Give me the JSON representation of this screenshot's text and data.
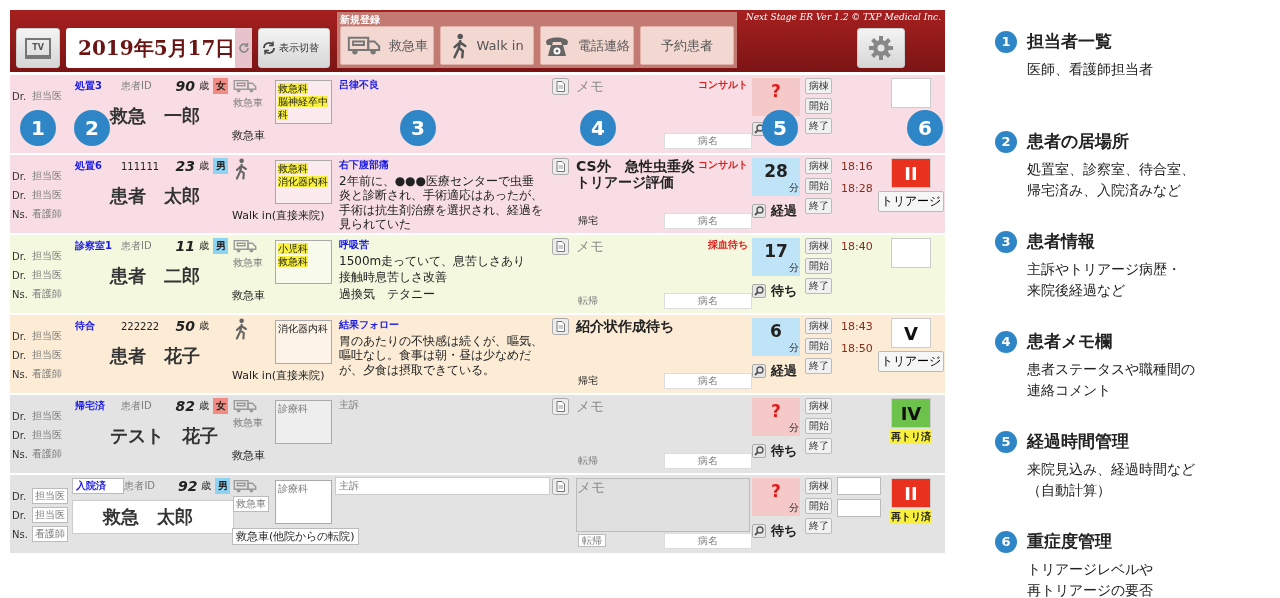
{
  "header": {
    "tv_button": "TV",
    "date": "2019年5月17日",
    "view_toggle": "表示切替",
    "register_group": {
      "title": "新規登録",
      "buttons": [
        {
          "kind": "ambulance",
          "label": "救急車"
        },
        {
          "kind": "walk",
          "label": "Walk in"
        },
        {
          "kind": "phone",
          "label": "電話連絡"
        },
        {
          "kind": "plain",
          "label": "予約患者"
        }
      ]
    },
    "version": "Next Stage ER Ver 1.2 © TXP Medical Inc."
  },
  "rows": [
    {
      "kind": "display",
      "color": "#f8dee4",
      "staff": [
        {
          "role": "Dr.",
          "placeholder": "担当医"
        }
      ],
      "location": "処置3",
      "patient_id": {
        "placeholder": "患者ID"
      },
      "age": "90",
      "age_unit": "歳",
      "sex": {
        "label": "女",
        "color": "#f08c84"
      },
      "name": "救急　一郎",
      "arrival": {
        "kind": "ambulance",
        "placeholder": "救急車",
        "label": "救急車"
      },
      "department": {
        "lines": [
          "救急科",
          "脳神経卒中科"
        ],
        "highlighted": true
      },
      "complaint": {
        "title": "呂律不良"
      },
      "memo": {
        "placeholder": "メモ"
      },
      "status": "コンサルト",
      "diagnosis": {
        "placeholder": "病名"
      },
      "timer": {
        "kind": "unknown",
        "value": "?"
      },
      "ward_buttons": [
        "病棟",
        "開始",
        "終了"
      ],
      "times": [],
      "triage": {
        "color": "#ffffff"
      }
    },
    {
      "kind": "display",
      "color": "#f8dee4",
      "staff": [
        {
          "role": "Dr.",
          "placeholder": "担当医"
        },
        {
          "role": "Dr.",
          "placeholder": "担当医"
        },
        {
          "role": "Ns.",
          "placeholder": "看護師"
        }
      ],
      "location": "処置6",
      "patient_id": {
        "value": "111111"
      },
      "age": "23",
      "age_unit": "歳",
      "sex": {
        "label": "男",
        "color": "#8fd3f2"
      },
      "name": "患者　太郎",
      "arrival": {
        "kind": "walk",
        "label": "Walk in(直接来院)"
      },
      "department": {
        "lines": [
          "救急科",
          "消化器内科"
        ],
        "highlighted": true
      },
      "complaint": {
        "title": "右下腹部痛",
        "lines": [
          "2年前に、●●●医療センターで虫垂炎と診断され、手術適応はあったが、手術は抗生剤治療を選択され、経過を見られていた"
        ]
      },
      "memo": {
        "lines": [
          "CS外　急性虫垂炎",
          "トリアージ評価"
        ]
      },
      "status": "コンサルト",
      "outcome": {
        "value": "帰宅"
      },
      "diagnosis": {
        "placeholder": "病名"
      },
      "timer": {
        "kind": "count",
        "value": "28",
        "unit": "分",
        "state": "経過"
      },
      "ward_buttons": [
        "病棟",
        "開始",
        "終了"
      ],
      "times": [
        "18:16",
        "18:28"
      ],
      "triage": {
        "level": "II",
        "color": "#e8321e",
        "note": {
          "kind": "button",
          "label": "トリアージ"
        }
      }
    },
    {
      "kind": "display",
      "color": "#f3f8df",
      "staff": [
        {
          "role": "Dr.",
          "placeholder": "担当医"
        },
        {
          "role": "Dr.",
          "placeholder": "担当医"
        },
        {
          "role": "Ns.",
          "placeholder": "看護師"
        }
      ],
      "location": "診察室1",
      "patient_id": {
        "placeholder": "患者ID"
      },
      "age": "11",
      "age_unit": "歳",
      "sex": {
        "label": "男",
        "color": "#8fd3f2"
      },
      "name": "患者　二郎",
      "arrival": {
        "kind": "ambulance",
        "placeholder": "救急車",
        "label": "救急車"
      },
      "department": {
        "lines": [
          "小児科",
          "救急科"
        ],
        "highlighted": true
      },
      "complaint": {
        "title": "呼吸苦",
        "lines": [
          "1500m走っていて、息苦しさあり",
          "接触時息苦しさ改善",
          "過換気　テタニー"
        ]
      },
      "memo": {
        "placeholder": "メモ"
      },
      "status": "採血待ち",
      "outcome": {
        "placeholder": "転帰"
      },
      "diagnosis": {
        "placeholder": "病名"
      },
      "timer": {
        "kind": "count",
        "value": "17",
        "unit": "分",
        "state": "待ち"
      },
      "ward_buttons": [
        "病棟",
        "開始",
        "終了"
      ],
      "times": [
        "18:40"
      ],
      "triage": {
        "color": "#ffffff"
      }
    },
    {
      "kind": "display",
      "color": "#fcecd6",
      "staff": [
        {
          "role": "Dr.",
          "placeholder": "担当医"
        },
        {
          "role": "Dr.",
          "placeholder": "担当医"
        },
        {
          "role": "Ns.",
          "placeholder": "看護師"
        }
      ],
      "location": "待合",
      "patient_id": {
        "value": "222222"
      },
      "age": "50",
      "age_unit": "歳",
      "name": "患者　花子",
      "arrival": {
        "kind": "walk",
        "label": "Walk in(直接来院)"
      },
      "department": {
        "lines": [
          "消化器内科"
        ],
        "highlighted": false
      },
      "complaint": {
        "title": "結果フォロー",
        "lines": [
          "胃のあたりの不快感は続くが、嘔気、嘔吐なし。食事は朝・昼は少なめだが、夕食は摂取できている。"
        ]
      },
      "memo": {
        "lines": [
          "紹介状作成待ち"
        ]
      },
      "outcome": {
        "value": "帰宅"
      },
      "diagnosis": {
        "placeholder": "病名"
      },
      "timer": {
        "kind": "count",
        "value": "6",
        "unit": "分",
        "state": "経過"
      },
      "ward_buttons": [
        "病棟",
        "開始",
        "終了"
      ],
      "times": [
        "18:43",
        "18:50"
      ],
      "triage": {
        "level": "V",
        "color": "#ffffff",
        "note": {
          "kind": "button",
          "label": "トリアージ"
        }
      }
    },
    {
      "kind": "display",
      "color": "#e3e3e3",
      "staff": [
        {
          "role": "Dr.",
          "placeholder": "担当医"
        },
        {
          "role": "Dr.",
          "placeholder": "担当医"
        },
        {
          "role": "Ns.",
          "placeholder": "看護師"
        }
      ],
      "location": "帰宅済",
      "patient_id": {
        "placeholder": "患者ID"
      },
      "age": "82",
      "age_unit": "歳",
      "sex": {
        "label": "女",
        "color": "#f08c84"
      },
      "name": "テスト　花子",
      "arrival": {
        "kind": "ambulance",
        "placeholder": "救急車",
        "label": "救急車"
      },
      "department": {
        "placeholder": "診療科"
      },
      "complaint": {
        "placeholder": "主訴"
      },
      "memo": {
        "placeholder": "メモ"
      },
      "outcome": {
        "placeholder": "転帰"
      },
      "diagnosis": {
        "placeholder": "病名"
      },
      "timer": {
        "kind": "unknown",
        "value": "?",
        "unit": "分",
        "state": "待ち"
      },
      "ward_buttons": [
        "病棟",
        "開始",
        "終了"
      ],
      "times": [],
      "triage": {
        "level": "IV",
        "color": "#6cc24a",
        "note": {
          "kind": "badge",
          "label": "再トリ済"
        }
      }
    },
    {
      "kind": "editing",
      "color": "#e3e3e3",
      "staff": [
        {
          "role": "Dr.",
          "placeholder": "担当医"
        },
        {
          "role": "Dr.",
          "placeholder": "担当医"
        },
        {
          "role": "Ns.",
          "placeholder": "看護師"
        }
      ],
      "location": "入院済",
      "patient_id": {
        "placeholder": "患者ID"
      },
      "age": "92",
      "age_unit": "歳",
      "sex": {
        "label": "男",
        "color": "#8fd3f2"
      },
      "name": "救急　太郎",
      "arrival": {
        "kind": "ambulance",
        "placeholder": "救急車",
        "label": "救急車(他院からの転院)"
      },
      "department": {
        "placeholder": "診療科"
      },
      "complaint": {
        "placeholder": "主訴"
      },
      "memo": {
        "placeholder": "メモ"
      },
      "outcome": {
        "placeholder": "転帰"
      },
      "diagnosis": {
        "placeholder": "病名"
      },
      "timer": {
        "kind": "unknown",
        "value": "?",
        "unit": "分",
        "state": "待ち"
      },
      "ward_buttons": [
        "病棟",
        "開始",
        "終了"
      ],
      "times": [],
      "triage": {
        "level": "II",
        "color": "#e8321e",
        "note": {
          "kind": "badge",
          "label": "再トリ済"
        }
      }
    }
  ],
  "callouts": [
    "1",
    "2",
    "3",
    "4",
    "5",
    "6"
  ],
  "legend": [
    {
      "number": "1",
      "title": "担当者一覧",
      "lines": [
        "医師、看護師担当者"
      ]
    },
    {
      "number": "2",
      "title": "患者の居場所",
      "lines": [
        "処置室、診察室、待合室、",
        "帰宅済み、入院済みなど"
      ]
    },
    {
      "number": "3",
      "title": "患者情報",
      "lines": [
        "主訴やトリアージ病歴・",
        "来院後経過など"
      ]
    },
    {
      "number": "4",
      "title": "患者メモ欄",
      "lines": [
        "患者ステータスや職種間の",
        "連絡コメント"
      ]
    },
    {
      "number": "5",
      "title": "経過時間管理",
      "lines": [
        "来院見込み、経過時間など",
        "（自動計算）"
      ]
    },
    {
      "number": "6",
      "title": "重症度管理",
      "lines": [
        "トリアージレベルや",
        "再トリアージの要否"
      ]
    }
  ]
}
